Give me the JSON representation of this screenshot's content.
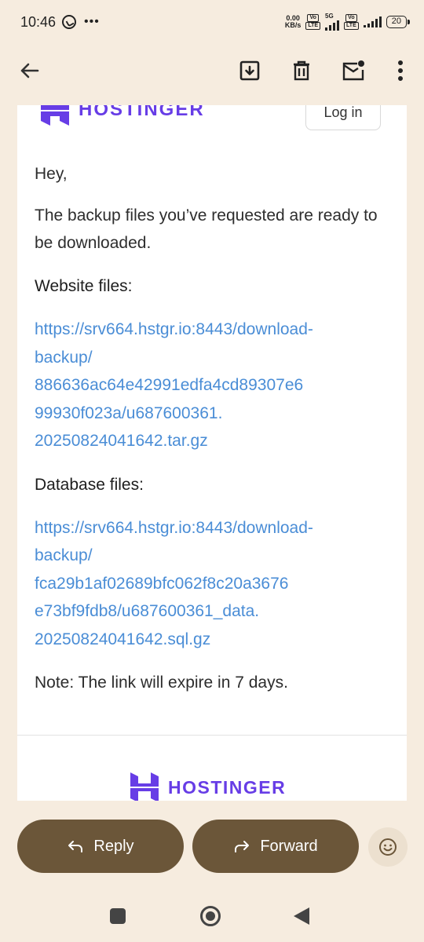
{
  "status_bar": {
    "time": "10:46",
    "net_speed_value": "0.00",
    "net_speed_unit": "KB/s",
    "network_type": "5G",
    "battery": "20",
    "vo_label": "Vo",
    "lte_label": "LTE"
  },
  "toolbar": {
    "back_icon": "arrow-left-icon",
    "archive_icon": "archive-icon",
    "delete_icon": "trash-icon",
    "mark_unread_icon": "mail-unread-icon",
    "more_icon": "more-vert-icon"
  },
  "email": {
    "header_logo_text": "HOSTINGER",
    "login_label": "Log in",
    "greeting": "Hey,",
    "intro": "The backup files you’ve requested are ready to be downloaded.",
    "website_label": "Website files:",
    "website_link": "https://srv664.hstgr.io:8443/download-backup/886636ac64e42991edfa4cd89307e699930f023a/u687600361.20250824041642.tar.gz",
    "database_label": "Database files:",
    "database_link": "https://srv664.hstgr.io:8443/download-backup/fca29b1af02689bfc062f8c20a3676e73bf9fdb8/u687600361_data.20250824041642.sql.gz",
    "note": "Note: The link will expire in 7 days.",
    "footer_logo_text": "HOSTINGER",
    "brand_color": "#673de6",
    "link_color": "#4a8dd6"
  },
  "actions": {
    "reply_label": "Reply",
    "forward_label": "Forward",
    "emoji_icon": "emoji-smile-icon",
    "button_color": "#6b5639"
  }
}
